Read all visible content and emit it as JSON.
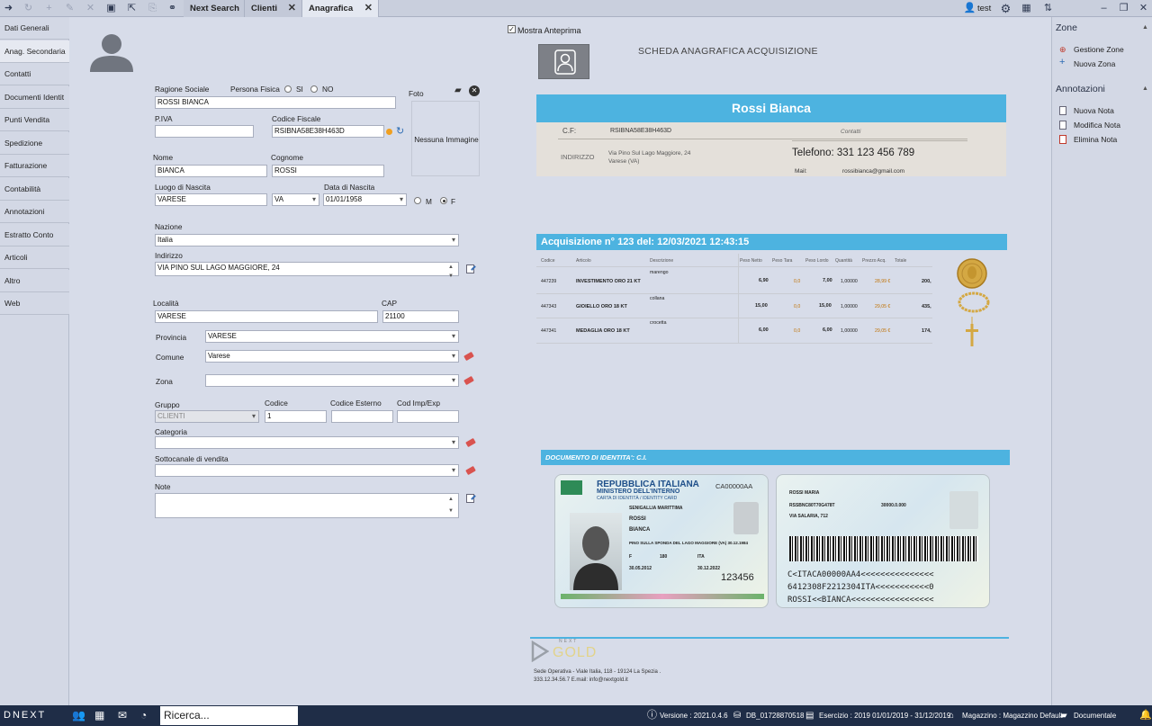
{
  "toolbar": {
    "tabs": [
      "Next Search",
      "Clienti",
      "Anagrafica"
    ],
    "user": "test"
  },
  "leftnav": {
    "items": [
      "Dati Generali",
      "Anag. Secondaria",
      "Contatti",
      "Documenti Identit",
      "Punti Vendita",
      "Spedizione",
      "Fatturazione",
      "Contabilità",
      "Annotazioni",
      "Estratto Conto",
      "Articoli",
      "Altro",
      "Web"
    ]
  },
  "form": {
    "ragione_sociale_label": "Ragione Sociale",
    "ragione_sociale": "ROSSI BIANCA",
    "persona_fisica_label": "Persona Fisica",
    "si": "SI",
    "no": "NO",
    "foto_label": "Foto",
    "nessuna_immagine": "Nessuna Immagine",
    "piva_label": "P.IVA",
    "piva": "",
    "cf_label": "Codice Fiscale",
    "cf": "RSIBNA58E38H463D",
    "nome_label": "Nome",
    "nome": "BIANCA",
    "cognome_label": "Cognome",
    "cognome": "ROSSI",
    "luogo_label": "Luogo di Nascita",
    "luogo": "VARESE",
    "prov_nascita": "VA",
    "data_label": "Data di Nascita",
    "data": "01/01/1958",
    "m": "M",
    "f": "F",
    "nazione_label": "Nazione",
    "nazione": "Italia",
    "indirizzo_label": "Indirizzo",
    "indirizzo": "VIA PINO SUL LAGO MAGGIORE, 24",
    "localita_label": "Località",
    "localita": "VARESE",
    "cap_label": "CAP",
    "cap": "21100",
    "provincia_label": "Provincia",
    "provincia": "VARESE",
    "comune_label": "Comune",
    "comune": "Varese",
    "zona_label": "Zona",
    "zona": "",
    "gruppo_label": "Gruppo",
    "gruppo": "CLIENTI",
    "codice_label": "Codice",
    "codice": "1",
    "codice_esterno_label": "Codice Esterno",
    "cod_imp_label": "Cod Imp/Exp",
    "categoria_label": "Categoria",
    "sottocanale_label": "Sottocanale di vendita",
    "note_label": "Note"
  },
  "preview": {
    "mostra_anteprima": "Mostra Anteprima",
    "title": "SCHEDA ANAGRAFICA ACQUISIZIONE",
    "name": "Rossi Bianca",
    "cf_label": "C.F:",
    "cf": "RSIBNA58E38H463D",
    "contatti": "Contatti",
    "indirizzo_label": "INDIRIZZO",
    "indirizzo_1": "Via Pino Sul Lago Maggiore, 24",
    "indirizzo_2": "Varese (VA)",
    "telefono": "Telefono: 331 123 456 789",
    "mail_label": "Mail:",
    "mail": "rossibianca@gmail.com",
    "acquisizione": "Acquisizione n° 123 del:  12/03/2021 12:43:15",
    "table_headers": [
      "Codice",
      "Articolo",
      "Descrizione",
      "Peso Netto",
      "Peso Tara",
      "Peso Lordo",
      "Quantità",
      "Prezzo Acq.",
      "Totale"
    ],
    "rows": [
      {
        "codice": "447239",
        "articolo": "INVESTIMENTO ORO 21 KT",
        "descrizione": "marengo",
        "netto": "6,90",
        "tara": "0,0",
        "lordo": "7,00",
        "qta": "1,00000",
        "prezzo": "28,99 €",
        "totale": "200,"
      },
      {
        "codice": "447343",
        "articolo": "GIOIELLO ORO 18 KT",
        "descrizione": "collana",
        "netto": "15,00",
        "tara": "0,0",
        "lordo": "15,00",
        "qta": "1,00000",
        "prezzo": "29,05 €",
        "totale": "435,"
      },
      {
        "codice": "447341",
        "articolo": "MEDAGLIA ORO 18 KT",
        "descrizione": "crocetta",
        "netto": "6,00",
        "tara": "0,0",
        "lordo": "6,00",
        "qta": "1,00000",
        "prezzo": "29,05 €",
        "totale": "174,"
      }
    ],
    "documento": "DOCUMENTO DI IDENTITA': C.I.",
    "card_front": {
      "repubblica": "REPUBBLICA ITALIANA",
      "ministero": "MINISTERO DELL'INTERNO",
      "carta": "CARTA DI IDENTITÀ / IDENTITY CARD",
      "number": "CA00000AA",
      "comune": "SENIGALLIA MARITTIMA",
      "cognome": "ROSSI",
      "nome": "BIANCA",
      "luogo": "PINO SULLA SPONDA DEL LAGO MAGGIORE (VA) 30.12.1984",
      "sesso": "F",
      "statura": "180",
      "nazionalita": "ITA",
      "emissione": "30.05.2012",
      "scadenza": "30.12.2022",
      "can": "123456"
    },
    "card_back": {
      "cognome_nome": "ROSSI MARIA",
      "cf": "RSSBNC80T70G478T",
      "indirizzo": "VIA SALARIA, 712",
      "estremi": "30000.0.000",
      "mrz1": "C<ITACA00000AA4<<<<<<<<<<<<<<<",
      "mrz2": "6412308F2212304ITA<<<<<<<<<<<0",
      "mrz3": "ROSSI<<BIANCA<<<<<<<<<<<<<<<<<"
    },
    "logo_small": "NEXT",
    "logo_big": "GOLD",
    "footer_1": "Sede Operativa - Viale Italia, 118 - 19124  La Spezia  .",
    "footer_2": "333.12.34.56.7  E.mail:  info@nextgold.it"
  },
  "rightpanel": {
    "zone_title": "Zone",
    "zone_items": [
      "Gestione Zone",
      "Nuova Zona"
    ],
    "annotazioni_title": "Annotazioni",
    "annotazioni_items": [
      "Nuova Nota",
      "Modifica Nota",
      "Elimina Nota"
    ]
  },
  "statusbar": {
    "brand": "DNEXT",
    "search": "Ricerca...",
    "versione": "Versione : 2021.0.4.6",
    "db": "DB_01728870518",
    "esercizio": "Esercizio : 2019 01/01/2019 - 31/12/2019",
    "magazzino": "Magazzino : Magazzino Default",
    "documentale": "Documentale"
  },
  "colors": {
    "accent_blue": "#4db3e0",
    "statusbar": "#1f2d47"
  }
}
